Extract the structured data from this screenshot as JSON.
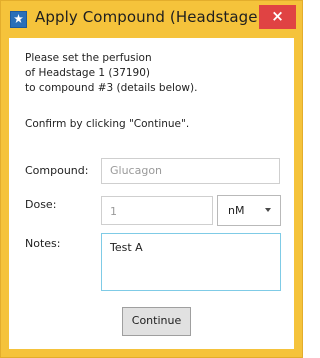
{
  "window": {
    "title": "Apply Compound (Headstage 1)",
    "close_glyph": "×",
    "app_icon": "app-logo-icon"
  },
  "message": {
    "line1": "Please set the perfusion",
    "line2": "of Headstage 1 (37190)",
    "line3": "to compound #3 (details below).",
    "line4": "Confirm by clicking \"Continue\"."
  },
  "form": {
    "compound_label": "Compound:",
    "compound_value": "Glucagon",
    "dose_label": "Dose:",
    "dose_value": "1",
    "dose_unit": "nM",
    "notes_label": "Notes:",
    "notes_value": "Test A"
  },
  "buttons": {
    "continue_label": "Continue"
  },
  "colors": {
    "title_bar": "#f5c33b",
    "close_button": "#e04343",
    "notes_border": "#7fcbe6",
    "app_icon": "#2a6fb8"
  }
}
